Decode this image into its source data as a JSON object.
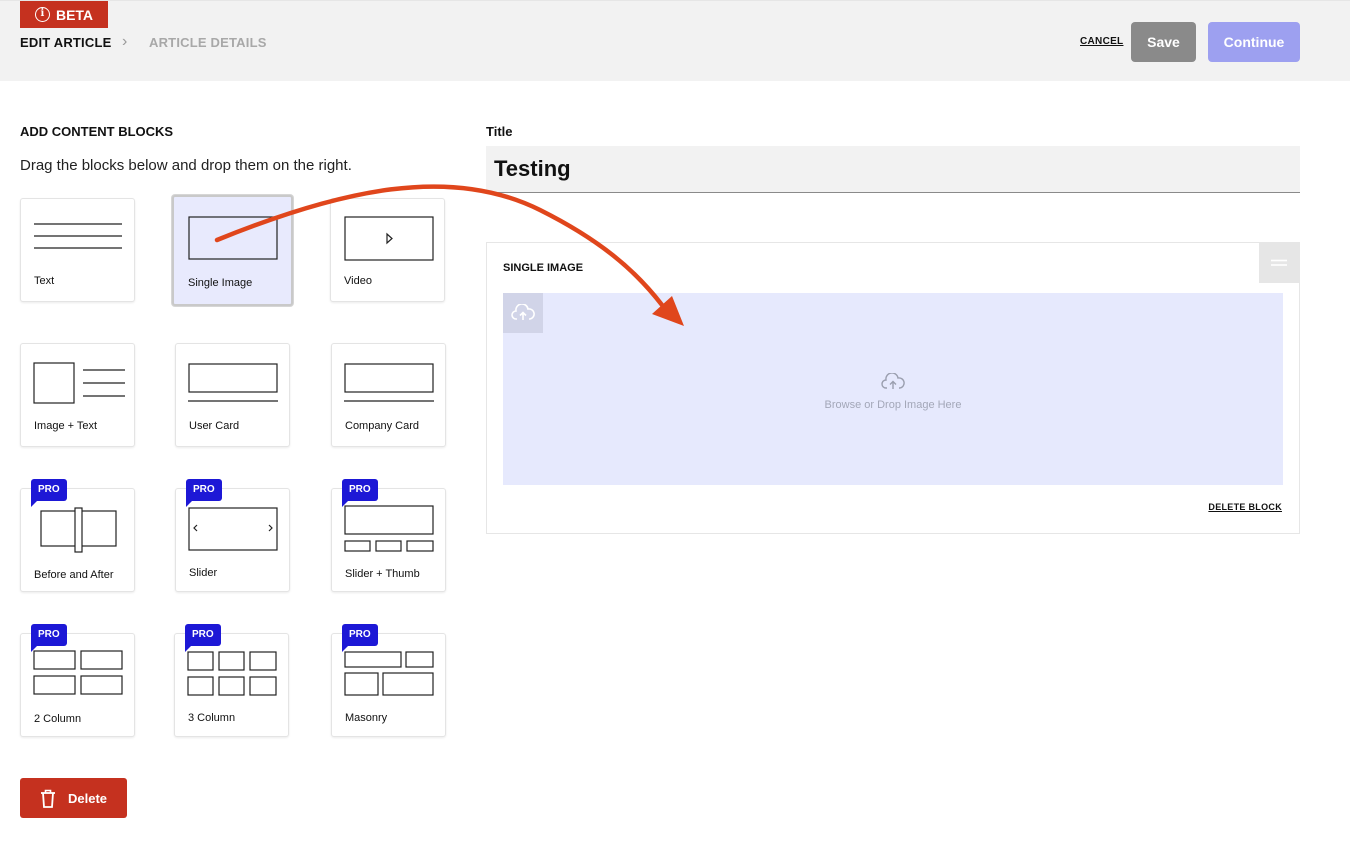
{
  "header": {
    "beta_label": "BETA",
    "breadcrumb": {
      "current": "EDIT ARTICLE",
      "next": "ARTICLE DETAILS"
    },
    "cancel_label": "CANCEL",
    "save_label": "Save",
    "continue_label": "Continue"
  },
  "left_panel": {
    "title": "ADD CONTENT BLOCKS",
    "subtitle": "Drag the blocks below and drop them on the right.",
    "pro_badge": "PRO",
    "blocks": {
      "text": "Text",
      "single_image": "Single Image",
      "video": "Video",
      "image_text": "Image + Text",
      "user_card": "User Card",
      "company_card": "Company Card",
      "before_after": "Before and After",
      "slider": "Slider",
      "slider_thumb": "Slider + Thumb",
      "two_column": "2 Column",
      "three_column": "3 Column",
      "masonry": "Masonry"
    },
    "delete_label": "Delete"
  },
  "right_panel": {
    "title_label": "Title",
    "title_value": "Testing",
    "block": {
      "heading": "SINGLE IMAGE",
      "drop_text": "Browse or Drop Image Here",
      "delete_label": "DELETE BLOCK"
    }
  },
  "colors": {
    "brand_red": "#c5311f",
    "pro_blue": "#1d18d6",
    "continue_purple": "#9da0f0",
    "dropzone_bg": "#e6e9fd",
    "arrow": "#e0461c"
  }
}
